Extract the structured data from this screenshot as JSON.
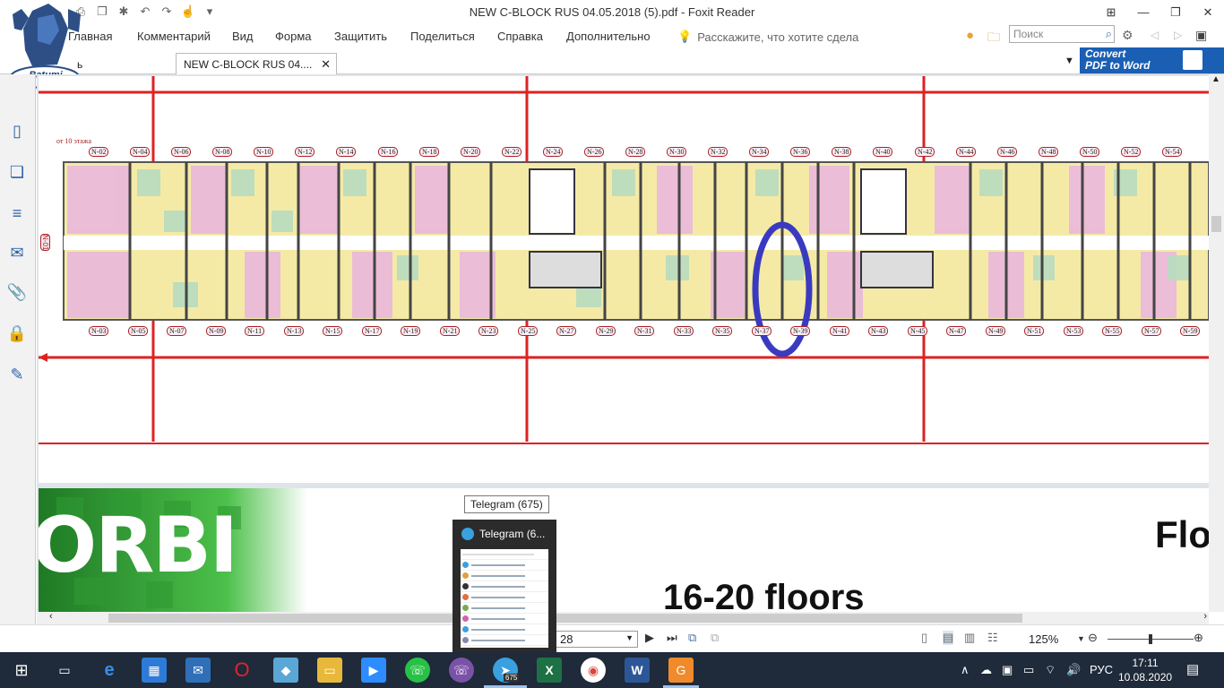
{
  "window": {
    "title": "NEW C-BLOCK RUS 04.05.2018 (5).pdf - Foxit Reader"
  },
  "menu": {
    "items": [
      "Главная",
      "Комментарий",
      "Вид",
      "Форма",
      "Защитить",
      "Поделиться",
      "Справка",
      "Дополнительно"
    ],
    "tell_me": "Расскажите, что хотите сдела",
    "search_placeholder": "Поиск"
  },
  "tabs": {
    "partial_tab": "ь",
    "active_tab": "NEW C-BLOCK RUS 04....",
    "convert_line1": "Convert",
    "convert_line2": "PDF to Word"
  },
  "logo": {
    "text_line1": "Batumi",
    "text_line2": "realtor"
  },
  "document": {
    "floor_note": "от 10 этажа",
    "side_label": "N-01",
    "top_units": [
      "N-02",
      "N-04",
      "N-06",
      "N-08",
      "N-10",
      "N-12",
      "N-14",
      "N-16",
      "N-18",
      "N-20",
      "N-22",
      "N-24",
      "N-26",
      "N-28",
      "N-30",
      "N-32",
      "N-34",
      "N-36",
      "N-38",
      "N-40",
      "N-42",
      "N-44",
      "N-46",
      "N-48",
      "N-50",
      "N-52",
      "N-54"
    ],
    "bottom_units": [
      "N-03",
      "N-05",
      "N-07",
      "N-09",
      "N-11",
      "N-13",
      "N-15",
      "N-17",
      "N-19",
      "N-21",
      "N-23",
      "N-25",
      "N-27",
      "N-29",
      "N-31",
      "N-33",
      "N-35",
      "N-37",
      "N-39",
      "N-41",
      "N-43",
      "N-45",
      "N-47",
      "N-49",
      "N-51",
      "N-53",
      "N-55",
      "N-57",
      "N-59"
    ],
    "page2_brand": "ORBI",
    "page2_heading_right": "Flo",
    "page2_heading": "16-20 floors",
    "highlight_color": "#3a3ac0"
  },
  "telegram": {
    "tooltip": "Telegram (675)",
    "preview_title": "Telegram (6...",
    "badge": "675"
  },
  "status": {
    "page_number": "28",
    "zoom": "125%"
  },
  "tray": {
    "language": "РУС",
    "time": "17:11",
    "date": "10.08.2020"
  }
}
